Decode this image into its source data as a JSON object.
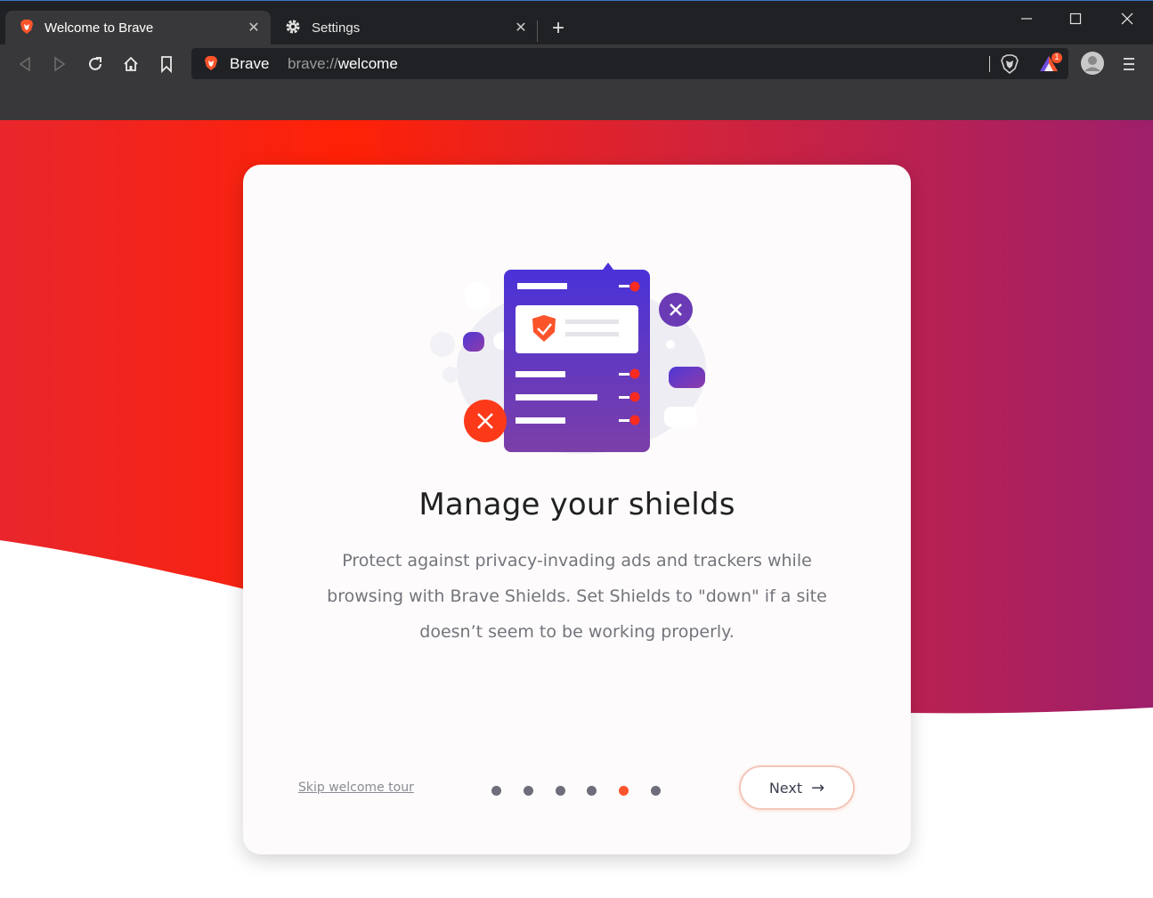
{
  "browser": {
    "tabs": [
      {
        "title": "Welcome to Brave",
        "active": true,
        "icon": "brave-lion-icon"
      },
      {
        "title": "Settings",
        "active": false,
        "icon": "gear-icon"
      }
    ],
    "new_tab_label": "+",
    "window_controls": [
      "minimize",
      "maximize",
      "close"
    ],
    "omnibox": {
      "brand": "Brave",
      "url_scheme": "brave://",
      "url_host": "welcome"
    },
    "rewards_badge": "1"
  },
  "welcome": {
    "title": "Manage your shields",
    "description": "Protect against privacy-invading ads and trackers while browsing with Brave Shields. Set Shields to \"down\" if a site doesn’t seem to be working properly.",
    "skip_label": "Skip welcome tour",
    "next_label": "Next",
    "steps_total": 6,
    "step_active": 5
  },
  "colors": {
    "accent": "#fb542b",
    "gradient_start": "#e8262c",
    "gradient_end": "#9e1f6b",
    "illustration_purple": "#5b3cc4"
  }
}
